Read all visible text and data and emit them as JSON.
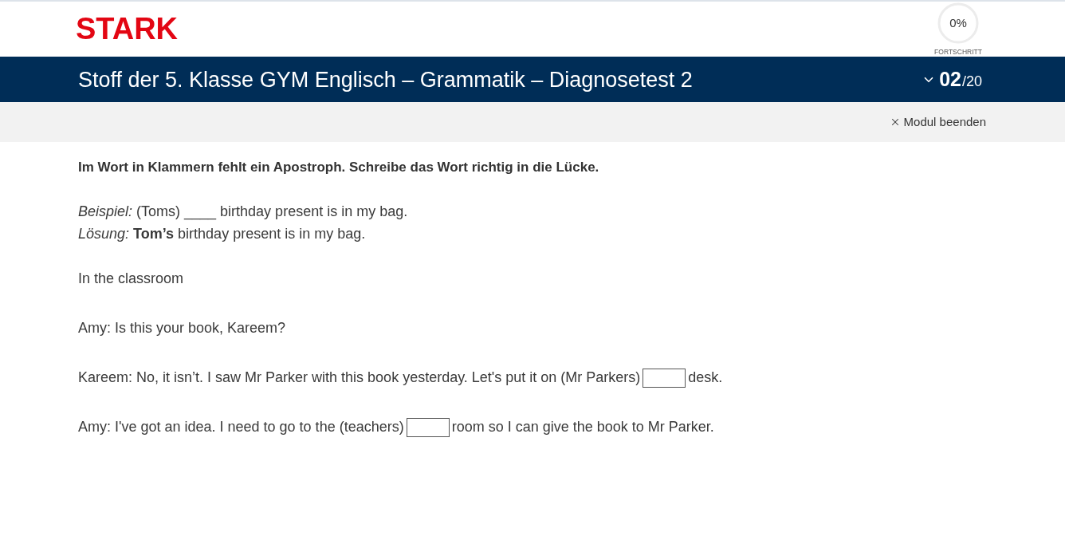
{
  "header": {
    "logo": "STARK",
    "progress": {
      "reading": "0%",
      "label": "FORTSCHRITT"
    }
  },
  "title_bar": {
    "title": "Stoff der 5. Klasse GYM Englisch – Grammatik – Diagnosetest 2",
    "counter": {
      "current": "02",
      "total": "/20"
    }
  },
  "toolbar": {
    "close_label": "Modul beenden"
  },
  "task": {
    "instruction": "Im Wort in Klammern fehlt ein Apostroph. Schreibe das Wort richtig in die Lücke.",
    "example": [
      "*Beispiel:* (Toms) ____ birthday present is in my bag.",
      "*Lösung:* **Tom’s** birthday present is in my bag."
    ],
    "heading": "In the classroom",
    "lines": [
      {
        "parts": [
          {
            "kind": "text",
            "text": "Amy: Is this your book, Kareem?"
          }
        ]
      },
      {
        "parts": [
          {
            "kind": "text",
            "text": "Kareem: No, it isn’t. I saw Mr Parker with this book yesterday. Let's put it on (Mr Parkers)"
          },
          {
            "kind": "gap"
          },
          {
            "kind": "text",
            "text": "desk."
          }
        ]
      },
      {
        "parts": [
          {
            "kind": "text",
            "text": "Amy: I've got an idea. I need to go to the (teachers)"
          },
          {
            "kind": "gap"
          },
          {
            "kind": "text",
            "text": "room so I can give the book to Mr Parker."
          }
        ]
      }
    ]
  }
}
